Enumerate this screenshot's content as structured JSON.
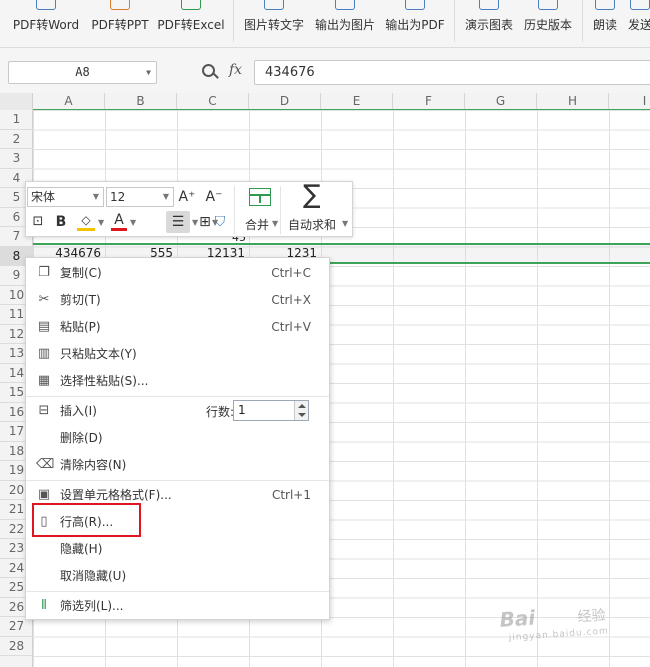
{
  "ribbon": {
    "items": [
      {
        "label": "PDF转Word"
      },
      {
        "label": "PDF转PPT"
      },
      {
        "label": "PDF转Excel"
      },
      {
        "label": "图片转文字"
      },
      {
        "label": "输出为图片"
      },
      {
        "label": "输出为PDF"
      },
      {
        "label": "演示图表"
      },
      {
        "label": "历史版本"
      },
      {
        "label": "朗读"
      },
      {
        "label": "发送"
      }
    ]
  },
  "formula_bar": {
    "name_box": "A8",
    "fx_label": "fx",
    "value": "434676"
  },
  "columns": [
    "A",
    "B",
    "C",
    "D",
    "E",
    "F",
    "G",
    "H",
    "I"
  ],
  "rows": [
    "1",
    "2",
    "3",
    "4",
    "5",
    "6",
    "7",
    "8",
    "9",
    "10",
    "11",
    "12",
    "13",
    "14",
    "15",
    "16",
    "17",
    "18",
    "19",
    "20",
    "21",
    "22",
    "23",
    "24",
    "25",
    "26",
    "27",
    "28"
  ],
  "row8": {
    "A": "434676",
    "B": "555",
    "C": "12131",
    "D": "1231"
  },
  "row7_partial": "45",
  "mini_toolbar": {
    "font": "宋体",
    "size": "12",
    "grow_label": "A⁺",
    "shrink_label": "A⁻",
    "bold_label": "B",
    "font_color_label": "A",
    "merge_label": "合并",
    "autosum_label": "自动求和"
  },
  "context_menu": {
    "items": [
      {
        "label": "复制(C)",
        "shortcut": "Ctrl+C",
        "icon": "copy-icon"
      },
      {
        "label": "剪切(T)",
        "shortcut": "Ctrl+X",
        "icon": "scissors-icon"
      },
      {
        "label": "粘贴(P)",
        "shortcut": "Ctrl+V",
        "icon": "paste-icon"
      },
      {
        "label": "只粘贴文本(Y)",
        "shortcut": "",
        "icon": "paste-text-icon"
      },
      {
        "label": "选择性粘贴(S)...",
        "shortcut": "",
        "icon": "paste-special-icon"
      },
      {
        "label": "插入(I)",
        "shortcut": "",
        "icon": "insert-row-icon"
      },
      {
        "label": "删除(D)",
        "shortcut": "",
        "icon": ""
      },
      {
        "label": "清除内容(N)",
        "shortcut": "",
        "icon": "eraser-icon"
      },
      {
        "label": "设置单元格格式(F)...",
        "shortcut": "Ctrl+1",
        "icon": "format-cells-icon"
      },
      {
        "label": "行高(R)...",
        "shortcut": "",
        "icon": "row-height-icon"
      },
      {
        "label": "隐藏(H)",
        "shortcut": "",
        "icon": ""
      },
      {
        "label": "取消隐藏(U)",
        "shortcut": "",
        "icon": ""
      },
      {
        "label": "筛选列(L)...",
        "shortcut": "",
        "icon": "filter-columns-icon"
      }
    ],
    "rows_label": "行数:",
    "rows_value": "1"
  },
  "watermark": {
    "brand": "Bai",
    "sub": "经验",
    "url": "jingyan.baidu.com"
  },
  "colors": {
    "selection_green": "#3fa45a",
    "highlight_red": "#e0161e",
    "font_color_red": "#e0161e",
    "fill_yellow": "#f5c400"
  }
}
